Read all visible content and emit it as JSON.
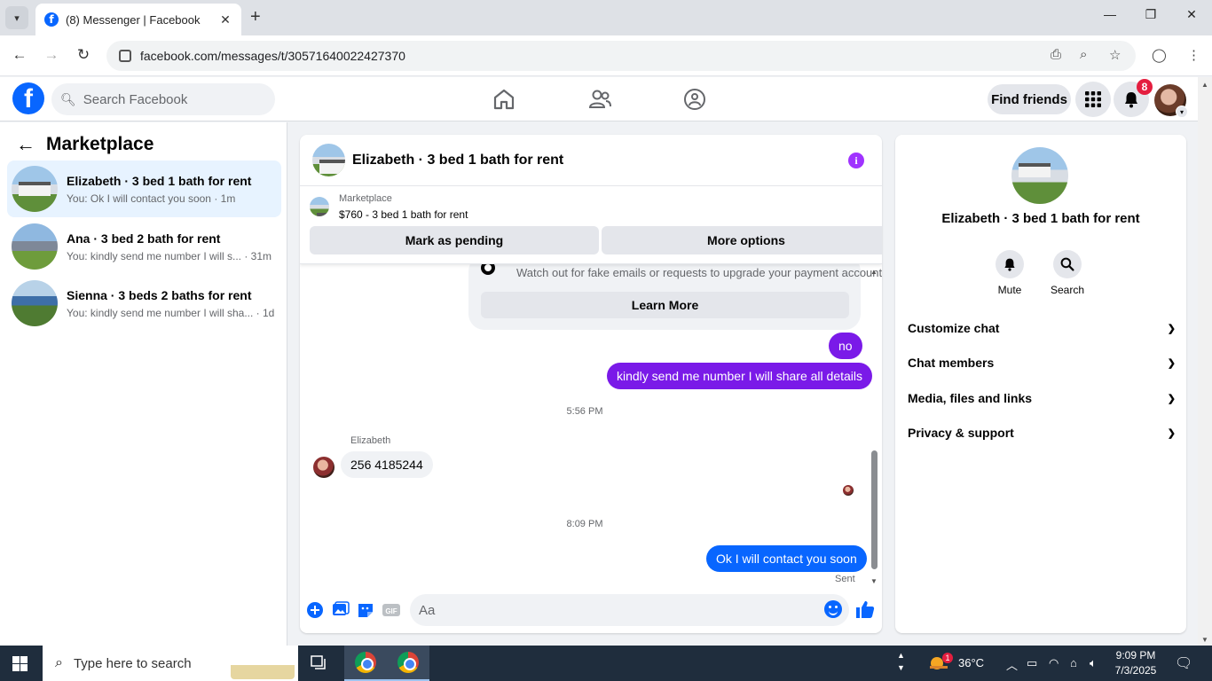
{
  "browser": {
    "tab_title": "(8) Messenger | Facebook",
    "url": "facebook.com/messages/t/30571640022427370",
    "new_tab_symbol": "+",
    "close_tab_symbol": "✕"
  },
  "fb": {
    "logo_letter": "f",
    "search_placeholder": "Search Facebook",
    "find_friends": "Find friends",
    "notification_count": "8"
  },
  "sidebar": {
    "title": "Marketplace",
    "conversations": [
      {
        "name": "Elizabeth · 3 bed 1 bath for rent",
        "preview": "You: Ok I will contact you soon · 1m"
      },
      {
        "name": "Ana · 3 bed 2 bath for rent",
        "preview": "You: kindly send me number I will s... · 31m"
      },
      {
        "name": "Sienna · 3 beds 2 baths for rent",
        "preview": "You: kindly send me number I will sha... · 1d"
      }
    ]
  },
  "chat": {
    "title": "Elizabeth · 3 bed 1 bath for rent",
    "marketplace_label": "Marketplace",
    "listing": "$760 - 3 bed 1 bath for rent",
    "mark_pending": "Mark as pending",
    "more_options": "More options",
    "safety_text": "Watch out for fake emails or requests to upgrade your payment account.",
    "learn_more": "Learn More",
    "messages": {
      "m1": "no",
      "m2": "kindly send me number I will share all details",
      "time1": "5:56 PM",
      "sender": "Elizabeth",
      "m3": "256 4185244",
      "time2": "8:09 PM",
      "m4": "Ok I will contact you soon",
      "status": "Sent"
    },
    "composer_placeholder": "Aa"
  },
  "details": {
    "name": "Elizabeth · 3 bed 1 bath for rent",
    "mute": "Mute",
    "search": "Search",
    "sections": [
      "Customize chat",
      "Chat members",
      "Media, files and links",
      "Privacy & support"
    ]
  },
  "taskbar": {
    "search_placeholder": "Type here to search",
    "weather": "36°C",
    "weather_badge": "1",
    "time": "9:09 PM",
    "date": "7/3/2025"
  },
  "colors": {
    "fb_blue": "#0866ff",
    "purple_bubble": "#7a1ae8",
    "active_conv": "#e7f3ff"
  }
}
